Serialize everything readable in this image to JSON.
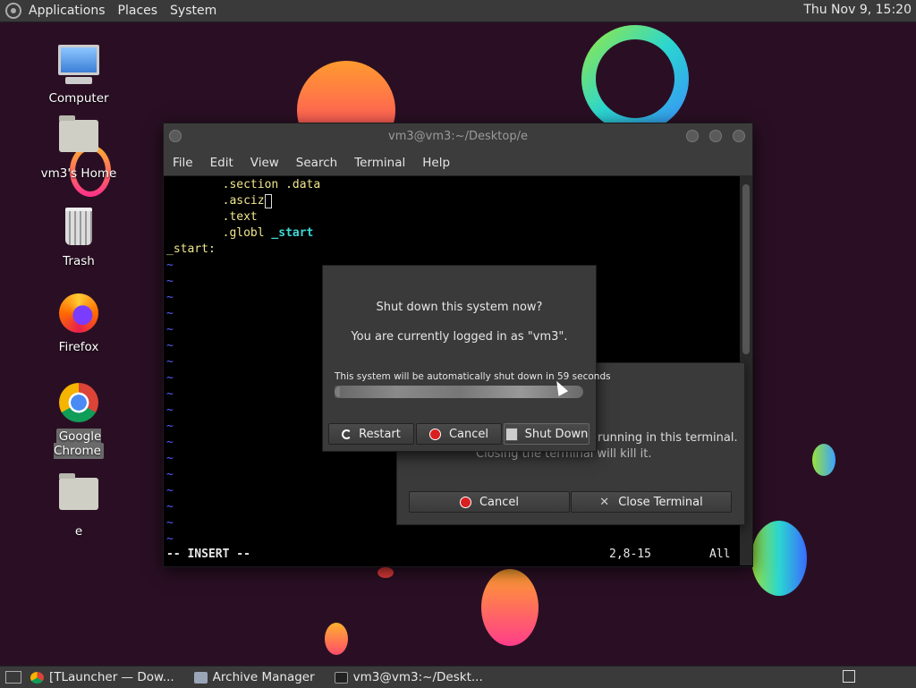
{
  "top_panel": {
    "menus": [
      "Applications",
      "Places",
      "System"
    ],
    "clock": "Thu Nov  9, 15:20"
  },
  "desktop_icons": [
    {
      "label": "Computer",
      "icon": "computer-icon"
    },
    {
      "label": "vm3's Home",
      "icon": "home-folder-icon"
    },
    {
      "label": "Trash",
      "icon": "trash-icon"
    },
    {
      "label": "Firefox",
      "icon": "firefox-icon"
    },
    {
      "label": "Google Chrome",
      "icon": "chrome-icon",
      "selected": true
    },
    {
      "label": "e",
      "icon": "folder-icon"
    }
  ],
  "terminal": {
    "title": "vm3@vm3:~/Desktop/e",
    "menus": [
      "File",
      "Edit",
      "View",
      "Search",
      "Terminal",
      "Help"
    ],
    "lines": [
      {
        "indent": "        ",
        "text": ".section .data"
      },
      {
        "indent": "        ",
        "text": ".asciz"
      },
      {
        "indent": "        ",
        "text": ".text"
      },
      {
        "indent": "        ",
        "text": ".globl",
        "extra": "_start"
      },
      {
        "indent": "",
        "text": "_start:"
      }
    ],
    "tilde": "~",
    "mode": "-- INSERT --",
    "position": "2,8-15",
    "scroll": "All"
  },
  "close_terminal_dialog": {
    "message_1": "running in this terminal.",
    "message_2": "Closing the terminal will kill it.",
    "cancel_label": "Cancel",
    "close_label": "Close Terminal"
  },
  "shutdown_dialog": {
    "question": "Shut down this system now?",
    "logged_in": "You are currently logged in as \"vm3\".",
    "countdown": "This system will be automatically shut down in 59 seconds",
    "progress": 0.02,
    "restart_label": "Restart",
    "cancel_label": "Cancel",
    "shutdown_label": "Shut Down"
  },
  "taskbar": {
    "tasks": [
      {
        "label": "[TLauncher — Dow...",
        "icon": "chrome-icon"
      },
      {
        "label": "Archive Manager",
        "icon": "archive-manager-icon"
      },
      {
        "label": "vm3@vm3:~/Deskt...",
        "icon": "terminal-icon"
      }
    ]
  },
  "colors": {
    "accent_red": "#d92020",
    "panel": "#3a3a3a",
    "background": "#2a0f24"
  }
}
